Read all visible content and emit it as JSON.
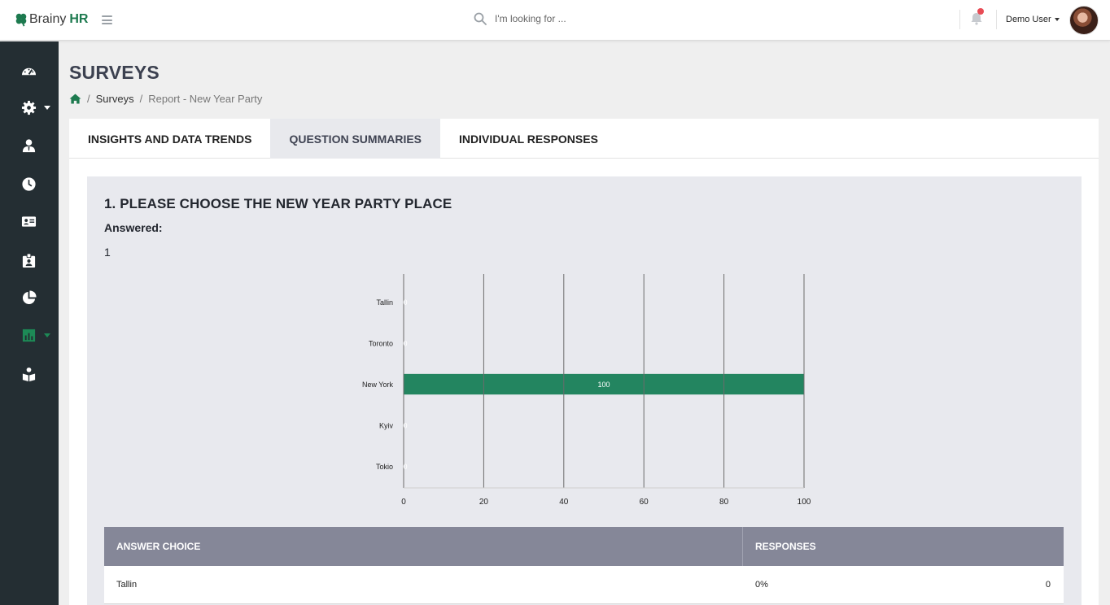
{
  "header": {
    "brand_name": "Brainy",
    "brand_suffix": "HR",
    "search_placeholder": "I'm looking for ...",
    "user_name": "Demo User",
    "icons": {
      "menu": "hamburger-icon",
      "search": "search-icon",
      "notifications": "bell-icon"
    },
    "notification_dot_color": "#e84b55"
  },
  "sidebar": {
    "items": [
      {
        "icon": "dashboard-icon"
      },
      {
        "icon": "gear-icon",
        "has_caret": true
      },
      {
        "icon": "user-icon"
      },
      {
        "icon": "clock-icon"
      },
      {
        "icon": "id-card-icon"
      },
      {
        "icon": "badge-icon"
      },
      {
        "icon": "pie-chart-icon"
      },
      {
        "icon": "bar-chart-icon",
        "has_caret": true,
        "active": true
      },
      {
        "icon": "book-reader-icon"
      }
    ],
    "active_color": "#1d8a56"
  },
  "page": {
    "title": "SURVEYS",
    "breadcrumb": {
      "surveys": "Surveys",
      "current": "Report - New Year Party"
    }
  },
  "tabs": [
    {
      "label": "INSIGHTS AND DATA TRENDS",
      "active": false
    },
    {
      "label": "QUESTION SUMMARIES",
      "active": true
    },
    {
      "label": "INDIVIDUAL RESPONSES",
      "active": false
    }
  ],
  "question": {
    "title": "1. PLEASE CHOOSE THE NEW YEAR PARTY PLACE",
    "answered_label": "Answered:",
    "answered_value": "1"
  },
  "chart_data": {
    "type": "bar",
    "orientation": "horizontal",
    "categories": [
      "Tallin",
      "Toronto",
      "New York",
      "Kyiv",
      "Tokio"
    ],
    "values": [
      0,
      0,
      100,
      0,
      0
    ],
    "xlim": [
      0,
      100
    ],
    "xticks": [
      0,
      20,
      40,
      60,
      80,
      100
    ],
    "grid": true,
    "bar_color": "#238560",
    "data_labels": true
  },
  "table": {
    "headers": [
      "ANSWER CHOICE",
      "RESPONSES"
    ],
    "rows": [
      {
        "choice": "Tallin",
        "percent": "0%",
        "count": "0"
      }
    ]
  }
}
